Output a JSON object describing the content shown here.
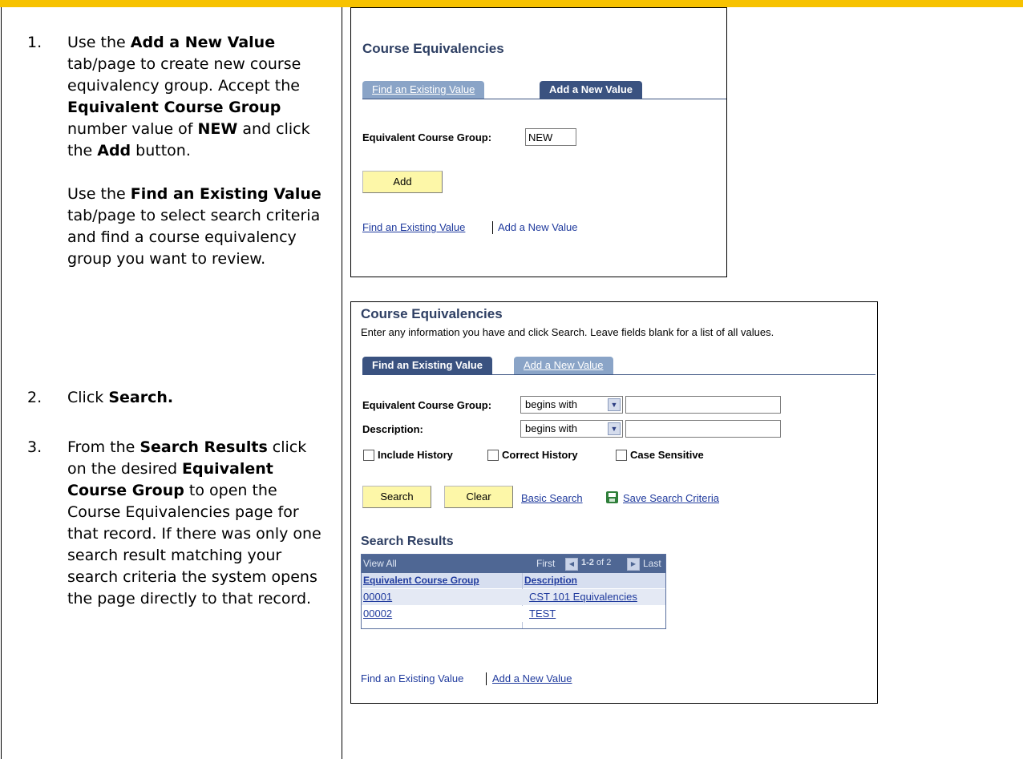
{
  "instructions": {
    "step1": {
      "num": "1.",
      "p1_a": "Use the ",
      "p1_b": "Add a New Value",
      "p1_c": " tab/page to create new course equivalency group. Accept the ",
      "p1_d": "Equivalent Course Group",
      "p1_e": " number value of ",
      "p1_f": "NEW",
      "p1_g": " and click the ",
      "p1_h": "Add",
      "p1_i": " button.",
      "p2_a": "Use the ",
      "p2_b": "Find an Existing Value",
      "p2_c": " tab/page to select search criteria and find a course equivalency group you want to review."
    },
    "step2": {
      "num": "2.",
      "a": "Click ",
      "b": "Search."
    },
    "step3": {
      "num": "3.",
      "a": "From the ",
      "b": "Search Results",
      "c": " click on the desired ",
      "d": "Equivalent Course Group",
      "e": " to open the Course Equivalencies page for that record.  If there was only one search result matching your search criteria the system opens the page directly to that record."
    }
  },
  "add_panel": {
    "title": "Course Equivalencies",
    "tab_find": "Find an Existing Value",
    "tab_add": "Add a New Value",
    "field_label": "Equivalent Course Group:",
    "field_value": "NEW",
    "add_button": "Add",
    "link_find": "Find an Existing Value",
    "text_add": "Add a New Value"
  },
  "search_panel": {
    "title": "Course Equivalencies",
    "subtitle": "Enter any information you have and click Search. Leave fields blank for a list of all values.",
    "tab_find": "Find an Existing Value",
    "tab_add": "Add a New Value",
    "group_label": "Equivalent Course Group:",
    "group_operator": "begins with",
    "group_value": "",
    "desc_label": "Description:",
    "desc_operator": "begins with",
    "desc_value": "",
    "include_history": "Include History",
    "correct_history": "Correct History",
    "case_sensitive": "Case Sensitive",
    "search_button": "Search",
    "clear_button": "Clear",
    "basic_search": "Basic Search",
    "save_criteria": "Save Search Criteria",
    "results_title": "Search Results",
    "grid": {
      "view_all": "View All",
      "first": "First",
      "range": "1-2",
      "of": "of 2",
      "last": "Last",
      "col1": "Equivalent Course Group",
      "col2": "Description",
      "rows": [
        {
          "group": "00001",
          "description": "CST 101 Equivalencies"
        },
        {
          "group": "00002",
          "description": "TEST"
        }
      ]
    },
    "text_find": "Find an Existing Value",
    "link_add": "Add a New Value"
  },
  "colors": {
    "top_bar": "#f7c200",
    "tab_active": "#3a5280",
    "tab_inactive": "#8aa4c7",
    "button": "#fdf7a8"
  }
}
